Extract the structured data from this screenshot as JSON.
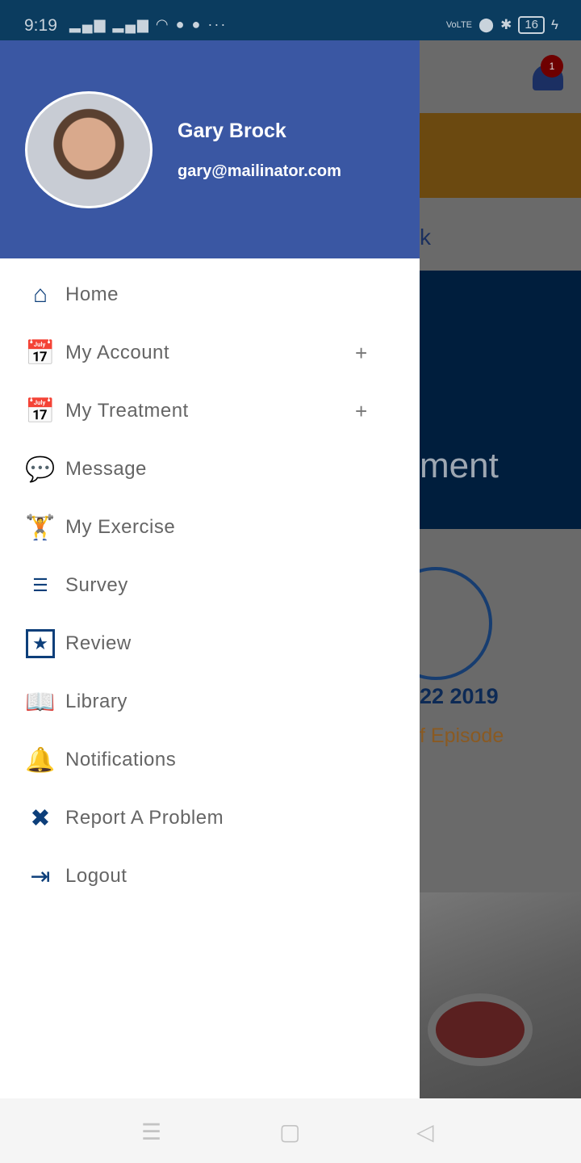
{
  "status_bar": {
    "time": "9:19",
    "battery": "16",
    "network": "VoLTE"
  },
  "background": {
    "partial_text_1": "k",
    "partial_title": "ment",
    "partial_date": "22 2019",
    "partial_episode": "f Episode",
    "notification_count": "1"
  },
  "drawer": {
    "user_name": "Gary Brock",
    "user_email": "gary@mailinator.com",
    "items": [
      {
        "label": "Home",
        "icon": "home-icon",
        "expandable": false
      },
      {
        "label": "My Account",
        "icon": "calendar-clock-icon",
        "expandable": true
      },
      {
        "label": "My Treatment",
        "icon": "calendar-clock-icon",
        "expandable": true
      },
      {
        "label": "Message",
        "icon": "chat-icon",
        "expandable": false
      },
      {
        "label": "My Exercise",
        "icon": "weightlifter-icon",
        "expandable": false
      },
      {
        "label": "Survey",
        "icon": "survey-icon",
        "expandable": false
      },
      {
        "label": "Review",
        "icon": "star-box-icon",
        "expandable": false
      },
      {
        "label": "Library",
        "icon": "open-book-icon",
        "expandable": false
      },
      {
        "label": "Notifications",
        "icon": "bell-icon",
        "expandable": false
      },
      {
        "label": "Report A Problem",
        "icon": "tools-icon",
        "expandable": false
      },
      {
        "label": "Logout",
        "icon": "logout-icon",
        "expandable": false
      }
    ],
    "expand_symbol": "+"
  },
  "colors": {
    "header": "#3a57a3",
    "icon": "#0d3f7a",
    "status_bar": "#0b3c5f"
  }
}
